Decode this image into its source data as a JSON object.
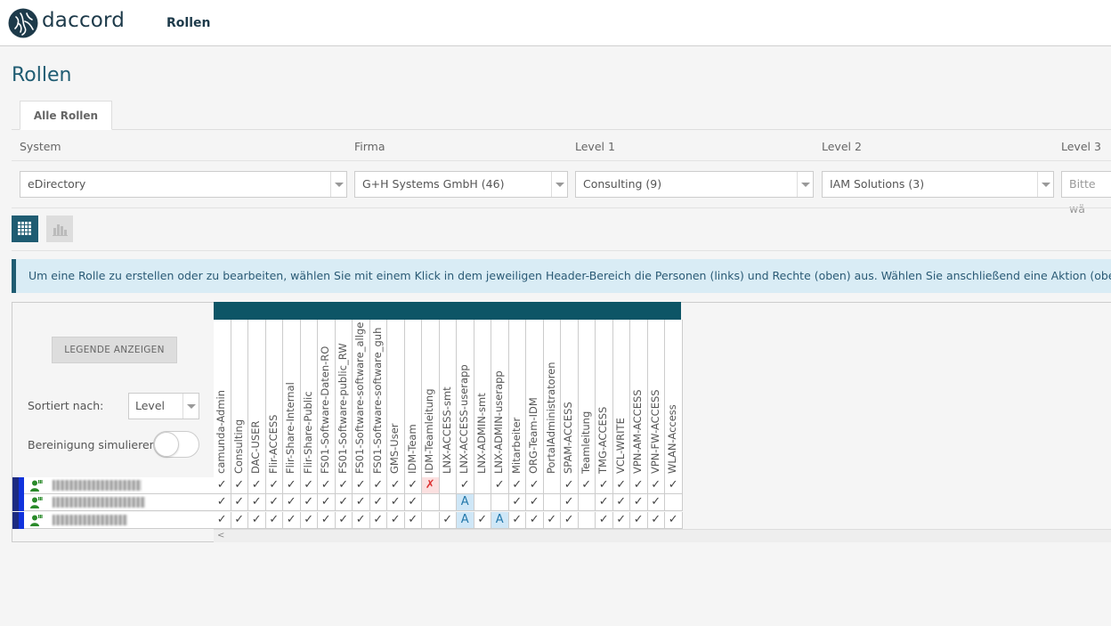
{
  "header": {
    "brand": "daccord",
    "nav_title": "Rollen"
  },
  "page": {
    "title": "Rollen",
    "tab_label": "Alle Rollen"
  },
  "filters": {
    "system": {
      "label": "System",
      "value": "eDirectory"
    },
    "firma": {
      "label": "Firma",
      "value": "G+H Systems GmbH (46)"
    },
    "level1": {
      "label": "Level 1",
      "value": "Consulting (9)"
    },
    "level2": {
      "label": "Level 2",
      "value": "IAM Solutions (3)"
    },
    "level3": {
      "label": "Level 3",
      "value": "Bitte wä"
    }
  },
  "info_text": "Um eine Rolle zu erstellen oder zu bearbeiten, wählen Sie mit einem Klick in dem jeweiligen Header-Bereich die Personen (links) und Rechte (oben) aus. Wählen Sie anschließend eine Aktion (oben rechts) aus,",
  "matrix": {
    "legend_button": "LEGENDE ANZEIGEN",
    "sort_label": "Sortiert nach:",
    "sort_value": "Level",
    "simulate_label": "Bereinigung simulieren:",
    "columns": [
      "camunda-Admin",
      "Consulting",
      "DAC-USER",
      "Flir-ACCESS",
      "Flir-Share-Internal",
      "Flir-Share-Public",
      "FS01-Software-Daten-RO",
      "FS01-Software-public_RW",
      "FS01-Software-software_allge",
      "FS01-Software-software_guh",
      "GMS-User",
      "IDM-Team",
      "IDM-Teamleitung",
      "LNX-ACCESS-smt",
      "LNX-ACCESS-userapp",
      "LNX-ADMIN-smt",
      "LNX-ADMIN-userapp",
      "Mitarbeiter",
      "ORG-Team-IDM",
      "PortalAdministratoren",
      "SPAM-ACCESS",
      "Teamleitung",
      "TMG-ACCESS",
      "VCL-WRITE",
      "VPN-AM-ACCESS",
      "VPN-FW-ACCESS",
      "WLAN-Access"
    ],
    "rows": [
      {
        "name_width": 100,
        "cells": [
          "✓",
          "✓",
          "✓",
          "✓",
          "✓",
          "✓",
          "✓",
          "✓",
          "✓",
          "✓",
          "✓",
          "✓",
          "✗",
          "",
          "✓",
          "",
          "✓",
          "✓",
          "✓",
          "",
          "✓",
          "✓",
          "✓",
          "✓",
          "✓",
          "✓",
          "✓"
        ]
      },
      {
        "name_width": 104,
        "cells": [
          "✓",
          "✓",
          "✓",
          "✓",
          "✓",
          "✓",
          "✓",
          "✓",
          "✓",
          "✓",
          "✓",
          "✓",
          "",
          "",
          "A",
          "",
          "",
          "✓",
          "✓",
          "",
          "✓",
          "",
          "✓",
          "✓",
          "✓",
          "✓",
          ""
        ]
      },
      {
        "name_width": 84,
        "cells": [
          "✓",
          "✓",
          "✓",
          "✓",
          "✓",
          "✓",
          "✓",
          "✓",
          "✓",
          "✓",
          "✓",
          "✓",
          "",
          "✓",
          "A",
          "✓",
          "A",
          "✓",
          "✓",
          "✓",
          "✓",
          "",
          "✓",
          "✓",
          "✓",
          "✓",
          "✓"
        ]
      }
    ],
    "scroll_left": "<"
  }
}
